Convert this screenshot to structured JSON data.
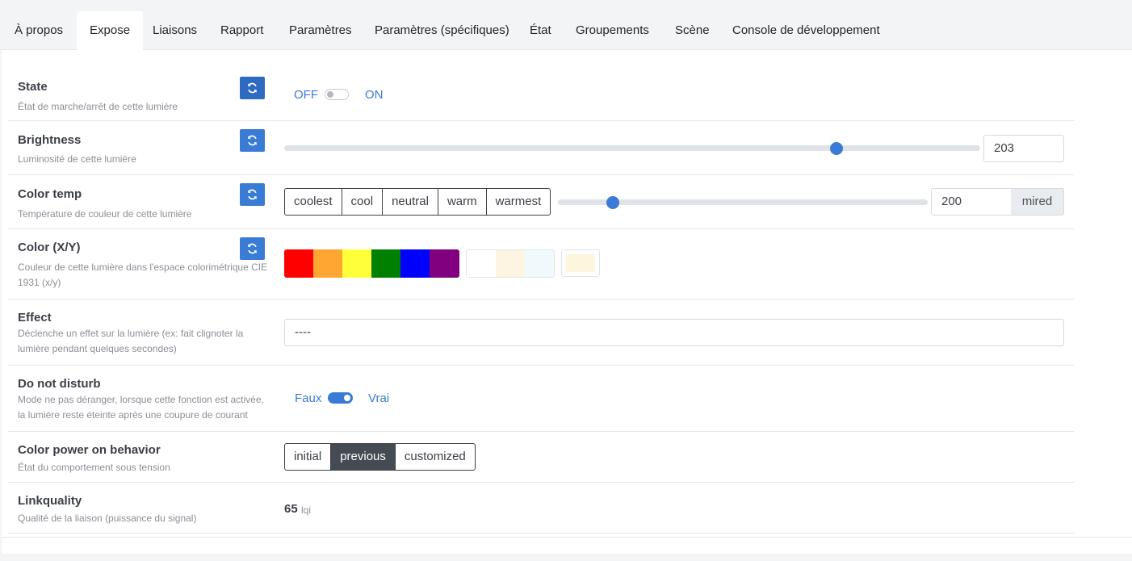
{
  "tabs": [
    {
      "label": "À propos"
    },
    {
      "label": "Expose"
    },
    {
      "label": "Liaisons"
    },
    {
      "label": "Rapport"
    },
    {
      "label": "Paramètres"
    },
    {
      "label": "Paramètres (spécifiques)"
    },
    {
      "label": "État"
    },
    {
      "label": "Groupements"
    },
    {
      "label": "Scène"
    },
    {
      "label": "Console de développement"
    }
  ],
  "active_tab": "Expose",
  "features": {
    "state": {
      "title": "State",
      "desc": "État de marche/arrêt de cette lumière",
      "off_label": "OFF",
      "on_label": "ON",
      "value": "OFF"
    },
    "brightness": {
      "title": "Brightness",
      "desc": "Luminosité de cette lumière",
      "value": "203",
      "min": 0,
      "max": 254
    },
    "color_temp": {
      "title": "Color temp",
      "desc": "Température de couleur de cette lumière",
      "presets": [
        "coolest",
        "cool",
        "neutral",
        "warm",
        "warmest"
      ],
      "value": "200",
      "unit": "mired",
      "slider_fraction": 0.146
    },
    "color_xy": {
      "title": "Color (X/Y)",
      "desc": "Couleur de cette lumière dans l'espace colorimétrique CIE 1931 (x/y)",
      "palette": [
        "#ff0000",
        "#ffa500",
        "#ffff3a",
        "#008000",
        "#0000ff",
        "#800080"
      ],
      "whites": [
        "#ffffff",
        "#fdf5e1",
        "#f0fafd"
      ],
      "current": "#fdf5dc"
    },
    "effect": {
      "title": "Effect",
      "desc": "Déclenche un effet sur la lumière (ex: fait clignoter la lumière pendant quelques secondes)",
      "value": "----"
    },
    "do_not_disturb": {
      "title": "Do not disturb",
      "desc": "Mode ne pas déranger, lorsque cette fonction est activée, la lumière reste éteinte après une coupure de courant",
      "off_label": "Faux",
      "on_label": "Vrai",
      "value": "Vrai"
    },
    "power_on_behavior": {
      "title": "Color power on behavior",
      "desc": "État du comportement sous tension",
      "options": [
        "initial",
        "previous",
        "customized"
      ],
      "selected": "previous"
    },
    "linkquality": {
      "title": "Linkquality",
      "desc": "Qualité de la liaison (puissance du signal)",
      "value": "65",
      "unit": "lqi"
    }
  }
}
